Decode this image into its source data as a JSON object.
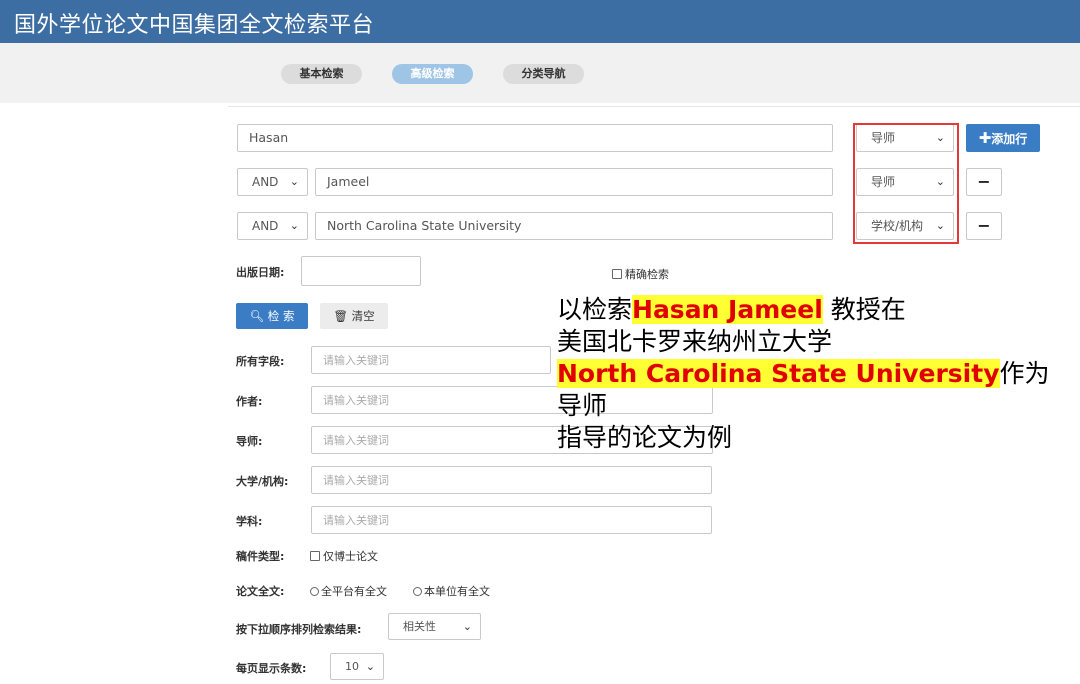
{
  "header": {
    "title": "国外学位论文中国集团全文检索平台"
  },
  "tabs": [
    {
      "label": "基本检索",
      "active": false
    },
    {
      "label": "高级检索",
      "active": true
    },
    {
      "label": "分类导航",
      "active": false
    }
  ],
  "search_rows": [
    {
      "operator": "",
      "value": "Hasan",
      "field": "导师"
    },
    {
      "operator": "AND",
      "value": "Jameel",
      "field": "导师"
    },
    {
      "operator": "AND",
      "value": "North Carolina State University",
      "field": "学校/机构"
    }
  ],
  "add_row_label": "添加行",
  "publish_date_label": "出版日期:",
  "exact_search_label": "精确检索",
  "search_button_label": "检 索",
  "clear_button_label": "清空",
  "fields": [
    {
      "label": "所有字段:",
      "placeholder": "请输入关键词"
    },
    {
      "label": "作者:",
      "placeholder": "请输入关键词"
    },
    {
      "label": "导师:",
      "placeholder": "请输入关键词"
    },
    {
      "label": "大学/机构:",
      "placeholder": "请输入关键词"
    },
    {
      "label": "学科:",
      "placeholder": "请输入关键词"
    }
  ],
  "doc_type": {
    "label": "稿件类型:",
    "option": "仅博士论文"
  },
  "fulltext": {
    "label": "论文全文:",
    "options": [
      "全平台有全文",
      "本单位有全文"
    ]
  },
  "sort": {
    "label": "按下拉顺序排列检索结果:",
    "value": "相关性"
  },
  "per_page": {
    "label": "每页显示条数:",
    "value": "10"
  },
  "annotation": {
    "line1_prefix": "以检索",
    "line1_name": "Hasan Jameel",
    "line1_suffix": " 教授在",
    "line2": "美国北卡罗来纳州立大学",
    "line3_school": "North Carolina State University",
    "line3_suffix": "作为",
    "line4": "导师",
    "line5": "指导的论文为例"
  },
  "colors": {
    "header_bg": "#3d6ea3",
    "primary_button": "#3a7dc4",
    "highlight": "#ffff33",
    "highlight_text": "#e00000",
    "red_box": "#e53935"
  }
}
